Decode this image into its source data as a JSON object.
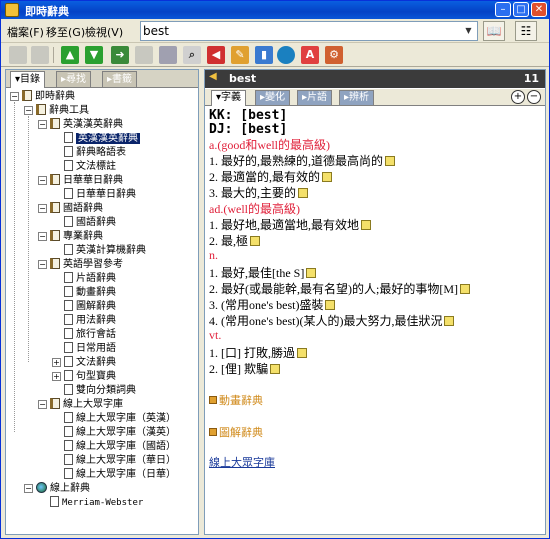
{
  "window": {
    "title": "即時辭典"
  },
  "menu": [
    {
      "label": "檔案(F)"
    },
    {
      "label": "移至(G)"
    },
    {
      "label": "檢視(V)"
    }
  ],
  "search": {
    "value": "best"
  },
  "toolbar_icons": [
    "save-icon",
    "print-icon",
    "up-arrow-icon",
    "down-arrow-icon",
    "export-icon",
    "copy-icon",
    "history-icon",
    "speaker-icon",
    "edit-icon",
    "bookmark-icon",
    "globe-icon",
    "font-icon",
    "settings-icon"
  ],
  "left_tabs": [
    {
      "label": "目錄",
      "active": true
    },
    {
      "label": "尋找",
      "active": false
    },
    {
      "label": "書籤",
      "active": false
    }
  ],
  "tree": {
    "root": "即時辭典",
    "dict_tools": "辭典工具",
    "eng_chi": "英漢漢英辭典",
    "eng_chi_items": [
      "英漢漢英辭典",
      "辭典略語表",
      "文法標註"
    ],
    "jp_chi": "日華華日辭典",
    "jp_chi_items": [
      "日華華日辭典"
    ],
    "guo_yu": "國語辭典",
    "guo_yu_items": [
      "國語辭典"
    ],
    "pro": "專業辭典",
    "pro_items": [
      "英漢計算機辭典"
    ],
    "learn": "英語學習參考",
    "learn_items": [
      "片語辭典",
      "動畫辭典",
      "圖解辭典",
      "用法辭典",
      "旅行會話",
      "日常用語",
      "文法辭典",
      "句型寶典",
      "雙向分類詞典"
    ],
    "online_corpus": "線上大眾字庫",
    "online_corpus_items": [
      "線上大眾字庫（英漢）",
      "線上大眾字庫（漢英）",
      "線上大眾字庫（國語）",
      "線上大眾字庫（華日）",
      "線上大眾字庫（日華）"
    ],
    "online_dict": "線上辭典",
    "online_dict_items": [
      "Merriam-Webster"
    ]
  },
  "entry": {
    "word": "best",
    "count": "11",
    "tabs": [
      "字義",
      "變化",
      "片語",
      "辨析"
    ],
    "kk": "KK: [best]",
    "dj": "DJ: [best]",
    "sections": [
      {
        "pos": "a.(good和well的最高級)",
        "defs": [
          "1. 最好的,最熟練的,道德最高尚的",
          "2. 最適當的,最有效的",
          "3. 最大的,主要的"
        ]
      },
      {
        "pos": "ad.(well的最高級)",
        "defs": [
          "1. 最好地,最適當地,最有效地",
          "2. 最,極"
        ]
      },
      {
        "pos": "n.",
        "defs": [
          "1. 最好,最佳[the S]",
          "2. 最好(或最能幹,最有名望)的人;最好的事物[M]",
          "3. (常用one's best)盛裝",
          "4. (常用one's best)(某人的)最大努力,最佳狀況"
        ]
      },
      {
        "pos": "vt.",
        "defs": [
          "1. [口] 打敗,勝過",
          "2. [俚] 欺騙"
        ]
      }
    ],
    "links": [
      "動畫辭典",
      "圖解辭典"
    ],
    "online_link": "線上大眾字庫"
  },
  "colors": {
    "title_bar": "#0442c6",
    "pos_red": "#e0203a",
    "link_orange": "#d08a1a",
    "link_blue": "#1a3a9a"
  }
}
